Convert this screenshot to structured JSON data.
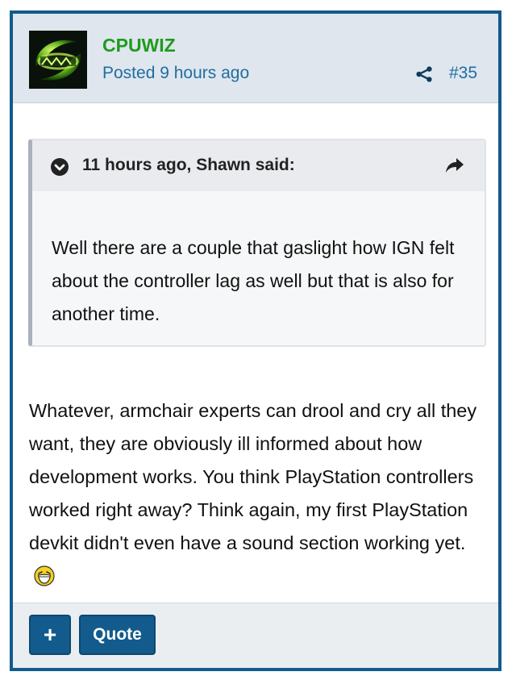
{
  "post": {
    "author": "CPUWIZ",
    "posted": "Posted 9 hours ago",
    "number": "#35",
    "quote": {
      "citation": "11 hours ago, Shawn said:",
      "text": "Well there are a couple that gaslight how IGN felt about the controller lag as well but that is also for another time."
    },
    "body": "Whatever, armchair experts can drool and cry all they want, they are obviously ill informed about how development works.  You think PlayStation controllers worked right away?  Think again, my first PlayStation devkit didn't even have a sound section working yet.",
    "emoji": "laughing-emoji"
  },
  "footer": {
    "plus_label": "+",
    "quote_label": "Quote"
  },
  "colors": {
    "accent": "#125b8c",
    "author": "#1e9c1e",
    "link": "#1f6ea3",
    "header_bg": "#dfe6ed"
  }
}
